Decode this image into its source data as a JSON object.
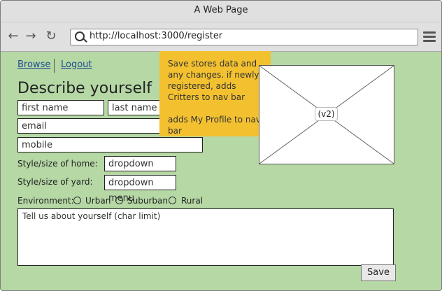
{
  "window": {
    "title": "A Web Page"
  },
  "browser": {
    "url": "http://localhost:3000/register",
    "back_icon": "arrow-left-icon",
    "forward_icon": "arrow-right-icon",
    "reload_icon": "reload-icon",
    "menu_icon": "hamburger-icon"
  },
  "nav": {
    "browse": "Browse",
    "logout": "Logout"
  },
  "form": {
    "heading": "Describe yourself",
    "first_name": "first name",
    "last_name": "last name",
    "email": "email",
    "mobile": "mobile",
    "home_label": "Style/size of home:",
    "home_value": "dropdown menu",
    "yard_label": "Style/size of yard:",
    "yard_value": "dropdown menu",
    "environment_label": "Environment:",
    "env_options": [
      "Urban",
      "Suburban",
      "Rural"
    ],
    "about_placeholder": "Tell us about yourself (char limit)",
    "save_label": "Save"
  },
  "note": {
    "line1": "Save stores data and any changes. if newly registered, adds Critters to nav bar",
    "line2": "adds My Profile to nav bar"
  },
  "image_placeholder": {
    "label": "(v2)"
  },
  "colors": {
    "page_bg": "#b5d8a5",
    "note_bg": "#f3c130",
    "link": "#1f4b8e"
  }
}
